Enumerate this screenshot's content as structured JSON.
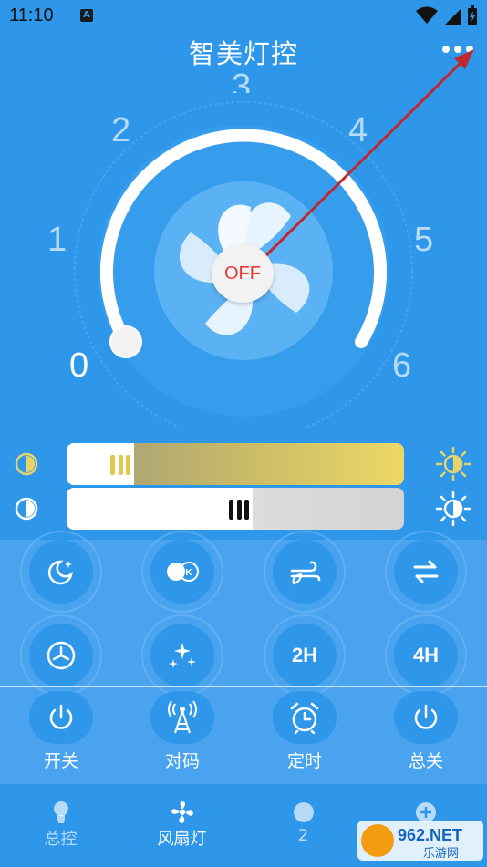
{
  "status_bar": {
    "time": "11:10",
    "notification_letter": "A"
  },
  "header": {
    "title": "智美灯控"
  },
  "dial": {
    "numbers": [
      "0",
      "1",
      "2",
      "3",
      "4",
      "5",
      "6"
    ],
    "active_level": 0,
    "power_label": "OFF"
  },
  "sliders": {
    "color_temp": {
      "value": 0.2
    },
    "brightness": {
      "value": 0.55
    }
  },
  "mode_buttons": [
    {
      "icon": "moon-star-icon"
    },
    {
      "icon": "toggle-k-icon"
    },
    {
      "icon": "wind-leaf-icon"
    },
    {
      "icon": "reverse-arrows-icon"
    },
    {
      "icon": "fan-circle-icon"
    },
    {
      "icon": "sparkles-icon"
    },
    {
      "icon": "timer-2h-icon",
      "label": "2H"
    },
    {
      "icon": "timer-4h-icon",
      "label": "4H"
    }
  ],
  "actions": [
    {
      "label": "开关",
      "icon": "power-icon"
    },
    {
      "label": "对码",
      "icon": "signal-tower-icon"
    },
    {
      "label": "定时",
      "icon": "alarm-clock-icon"
    },
    {
      "label": "总关",
      "icon": "power-icon"
    }
  ],
  "nav": [
    {
      "label": "总控",
      "icon": "bulb-icon"
    },
    {
      "label": "风扇灯",
      "icon": "fan-icon"
    },
    {
      "label": "2",
      "icon": "circle-icon"
    },
    {
      "label": "",
      "icon": "plus-icon"
    }
  ],
  "watermark": {
    "text_big": "962.NET",
    "text_small": "乐游网"
  },
  "colors": {
    "background": "#2f97ea",
    "panel": "#4aa3ee",
    "off_text": "#e53935",
    "warm_slider": "#e8d36a",
    "annotation_arrow": "#c0282d"
  }
}
